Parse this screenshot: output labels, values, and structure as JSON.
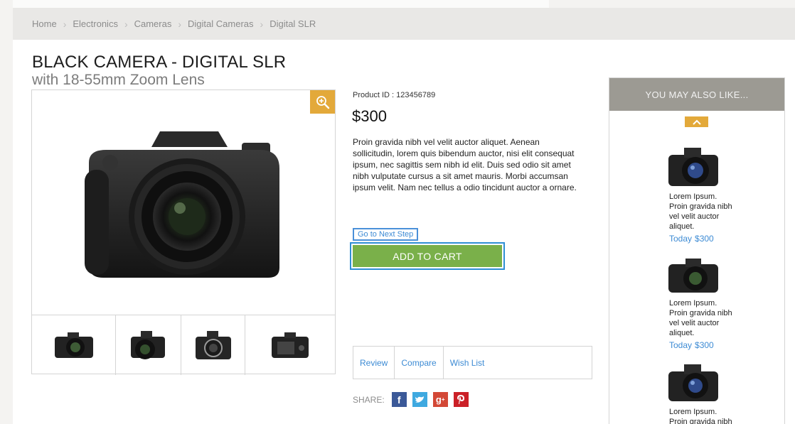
{
  "breadcrumb": [
    "Home",
    "Electronics",
    "Cameras",
    "Digital Cameras",
    "Digital SLR"
  ],
  "product": {
    "title": "BLACK CAMERA - DIGITAL SLR",
    "subtitle": "with 18-55mm Zoom Lens",
    "product_id": "Product ID : 123456789",
    "price": "$300",
    "description": "Proin gravida nibh vel velit auctor aliquet. Aenean sollicitudin, lorem quis bibendum auctor, nisi elit consequat ipsum, nec sagittis sem nibh id elit. Duis sed odio sit amet nibh vulputate cursus a sit amet mauris. Morbi accumsan ipsum velit. Nam nec tellus a odio tincidunt auctor a ornare.",
    "next_step_label": "Go to Next Step",
    "add_to_cart_label": "ADD TO CART"
  },
  "actions": {
    "review": "Review",
    "compare": "Compare",
    "wishlist": "Wish List"
  },
  "share": {
    "label": "SHARE:",
    "networks": [
      "facebook-icon",
      "twitter-icon",
      "google-plus-icon",
      "pinterest-icon"
    ]
  },
  "sidebar": {
    "title": "YOU MAY ALSO LIKE...",
    "items": [
      {
        "text": "Lorem Ipsum. Proin gravida nibh vel velit auctor aliquet.",
        "date": "Today",
        "price": "$300"
      },
      {
        "text": "Lorem Ipsum. Proin gravida nibh vel velit auctor aliquet.",
        "date": "Today",
        "price": "$300"
      },
      {
        "text": "Lorem Ipsum. Proin gravida nibh vel velit",
        "date": "",
        "price": ""
      }
    ]
  },
  "colors": {
    "accent": "#e3a93a",
    "cart": "#7ab04a",
    "link": "#3d8bd4",
    "sidebar_header": "#9c9a93",
    "facebook": "#3b5998",
    "twitter": "#3fa9e0",
    "google_plus": "#d34836",
    "pinterest": "#cb2027"
  }
}
